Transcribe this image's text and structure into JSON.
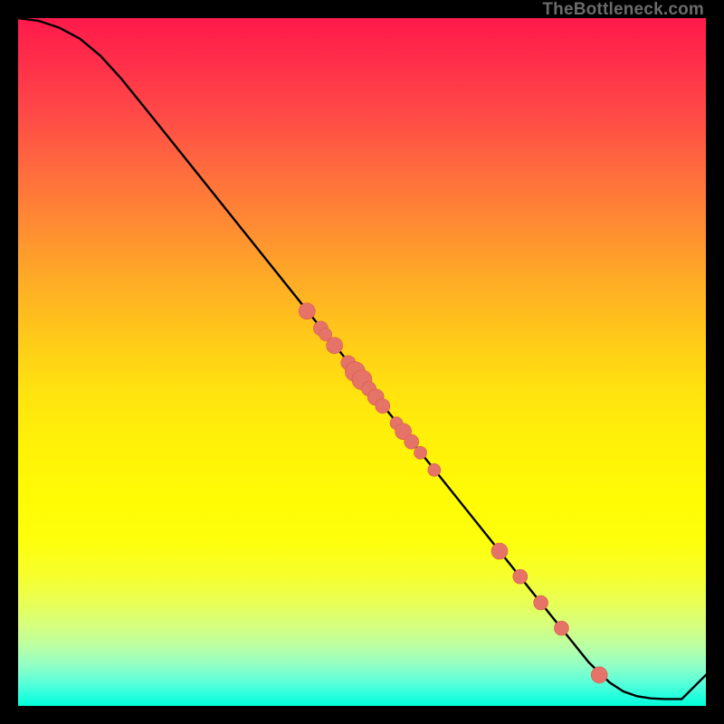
{
  "watermark": "TheBottleneck.com",
  "colors": {
    "background": "#000000",
    "curve_stroke": "#000000",
    "marker_fill": "#e57368",
    "marker_stroke": "#d85a50"
  },
  "chart_data": {
    "type": "line",
    "title": "",
    "xlabel": "",
    "ylabel": "",
    "xlim": [
      0,
      100
    ],
    "ylim": [
      0,
      100
    ],
    "curve": {
      "x": [
        0,
        3,
        6,
        9,
        12,
        15,
        20,
        30,
        40,
        50,
        60,
        70,
        78,
        83,
        86,
        88,
        90,
        92,
        94,
        96.5,
        100
      ],
      "y": [
        100,
        99.6,
        98.6,
        97,
        94.5,
        91.2,
        85,
        72.5,
        60,
        47.5,
        35,
        22.5,
        12.5,
        6.3,
        3.4,
        2.1,
        1.4,
        1.1,
        1.0,
        1.0,
        4.5
      ]
    },
    "markers": {
      "x": [
        42,
        44,
        44.7,
        46,
        48,
        49,
        50,
        51,
        52,
        53,
        55,
        56,
        57.2,
        58.5,
        60.5,
        70,
        73,
        76,
        79,
        84.5
      ],
      "y": [
        57.4,
        54.9,
        54.0,
        52.4,
        49.9,
        48.6,
        47.4,
        46.1,
        44.9,
        43.6,
        41.1,
        39.9,
        38.4,
        36.8,
        34.3,
        22.5,
        18.8,
        15.0,
        11.3,
        4.5
      ],
      "size": [
        9,
        8,
        7,
        9,
        8,
        11,
        11,
        8,
        9,
        8,
        7,
        9,
        8,
        7,
        7,
        9,
        8,
        8,
        8,
        9
      ]
    }
  }
}
